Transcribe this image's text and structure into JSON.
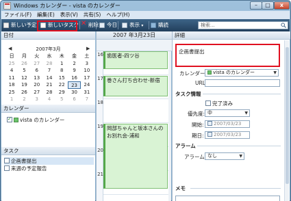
{
  "window": {
    "title": "Windows カレンダー - vista のカレンダー",
    "min": "–",
    "max": "□",
    "close": "x"
  },
  "menu": [
    "ファイル(F)",
    "編集(E)",
    "表示(V)",
    "共有(S)",
    "ヘルプ(H)"
  ],
  "toolbar": {
    "new_appointment": "新しい予定",
    "new_task": "新しいタスク",
    "delete": "削除",
    "today": "今日",
    "view": "表示",
    "subscribe": "購読",
    "search_placeholder": "検索..."
  },
  "left": {
    "date_header": "日付",
    "month_label": "2007年3月",
    "nav_prev": "◀",
    "nav_next": "▶",
    "weekdays": [
      "日",
      "月",
      "火",
      "水",
      "木",
      "金",
      "土"
    ],
    "weeks": [
      [
        "25",
        "26",
        "27",
        "28",
        "1",
        "2",
        "3"
      ],
      [
        "4",
        "5",
        "6",
        "7",
        "8",
        "9",
        "10"
      ],
      [
        "11",
        "12",
        "13",
        "14",
        "15",
        "16",
        "17"
      ],
      [
        "18",
        "19",
        "20",
        "21",
        "22",
        "23",
        "24"
      ],
      [
        "25",
        "26",
        "27",
        "28",
        "29",
        "30",
        "31"
      ],
      [
        "1",
        "2",
        "3",
        "4",
        "5",
        "6",
        "7"
      ]
    ],
    "calendar_header": "カレンダー",
    "calendar_name": "vista のカレンダー",
    "tasks_header": "タスク",
    "tasks": [
      "企画書提出",
      "来週の予定報告"
    ]
  },
  "day": {
    "header": "2007 年3月23日",
    "hours": [
      "16",
      "17",
      "18",
      "19",
      "20",
      "21"
    ],
    "events": [
      "歯医者-四ツ谷",
      "巻さん打ち合わせ-新宿",
      "岡部ちゃんと坂本さんのお別れ会-浦和"
    ]
  },
  "detail": {
    "header": "詳細",
    "task_title": "企画書提出",
    "calendar_label": "カレンダー:",
    "calendar_value": "vista のカレンダー",
    "url_label": "URL:",
    "task_info": "タスク情報",
    "completed_label": "完了済み",
    "priority_label": "優先度:",
    "priority_value": "中",
    "start_label": "開始:",
    "start_value": "2007/03/23",
    "due_label": "期日:",
    "due_value": "2007/03/23",
    "alarm_section": "アラーム",
    "alarm_label": "アラーム:",
    "alarm_value": "なし",
    "memo_section": "メモ"
  }
}
